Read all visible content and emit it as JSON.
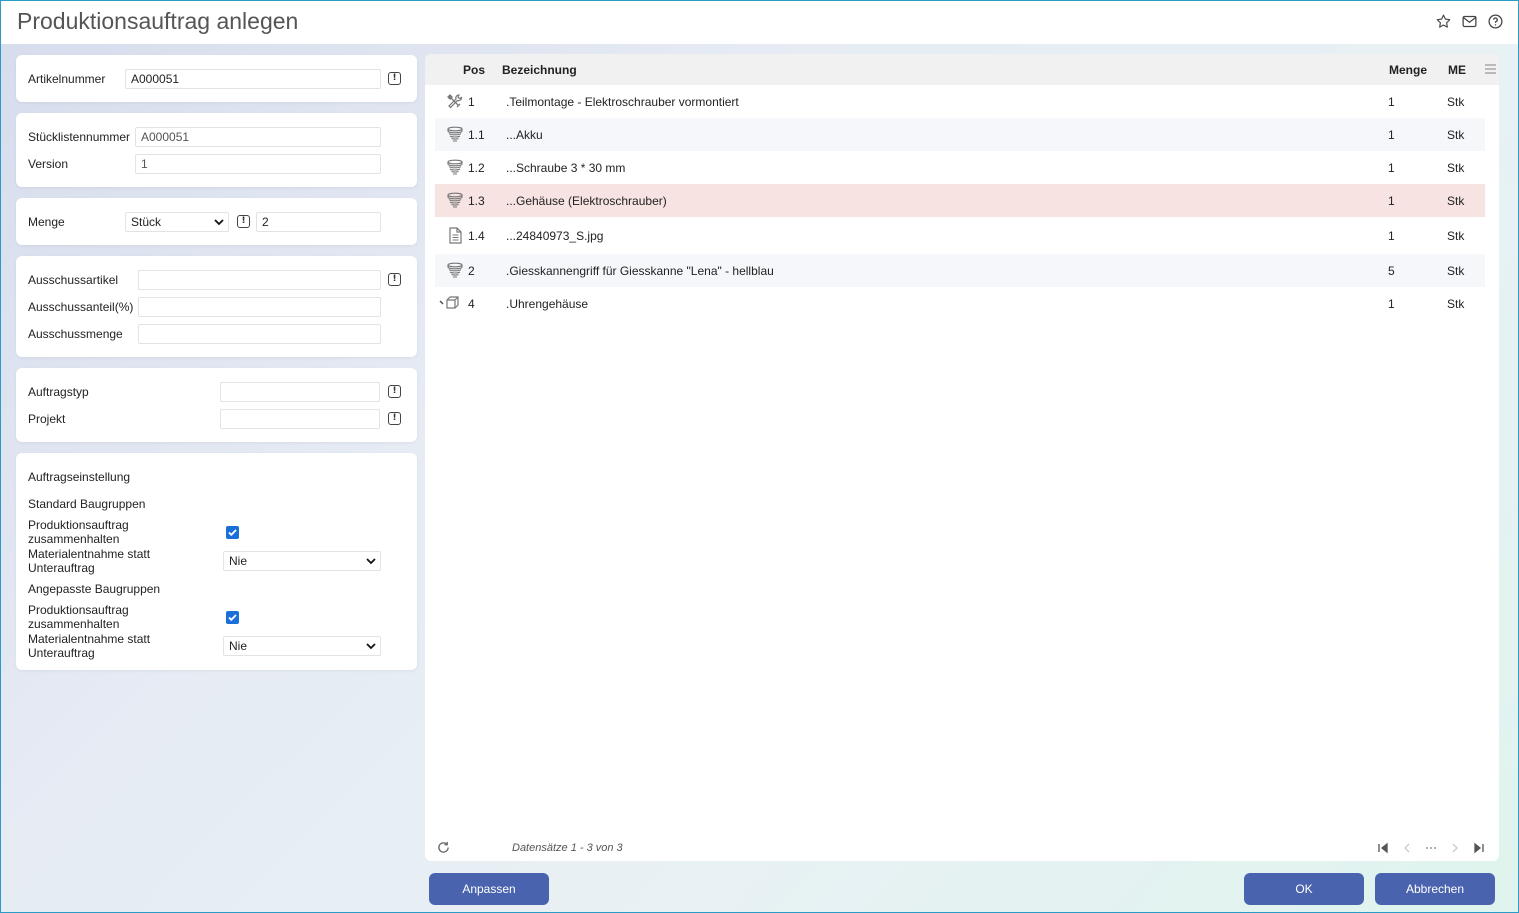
{
  "window": {
    "title": "Produktionsauftrag anlegen"
  },
  "header_icons": [
    "star-icon",
    "mail-icon",
    "help-icon"
  ],
  "article": {
    "label": "Artikelnummer",
    "value": "A000051"
  },
  "bom": {
    "number_label": "Stücklistennummer",
    "number_value": "A000051",
    "version_label": "Version",
    "version_value": "1"
  },
  "quantity": {
    "label": "Menge",
    "unit": "Stück",
    "value": "2"
  },
  "scrap": {
    "article_label": "Ausschussartikel",
    "article_value": "",
    "share_label": "Ausschussanteil(%)",
    "share_value": "",
    "qty_label": "Ausschussmenge",
    "qty_value": ""
  },
  "order": {
    "type_label": "Auftragstyp",
    "type_value": "",
    "project_label": "Projekt",
    "project_value": ""
  },
  "settings": {
    "title": "Auftragseinstellung",
    "standard": {
      "title": "Standard Baugruppen",
      "keep_label_1": "Produktionsauftrag",
      "keep_label_2": "zusammenhalten",
      "keep_checked": true,
      "withdraw_label_1": "Materialentnahme statt",
      "withdraw_label_2": "Unterauftrag",
      "withdraw_value": "Nie"
    },
    "custom": {
      "title": "Angepasste Baugruppen",
      "keep_label_1": "Produktionsauftrag",
      "keep_label_2": "zusammenhalten",
      "keep_checked": true,
      "withdraw_label_1": "Materialentnahme statt",
      "withdraw_label_2": "Unterauftrag",
      "withdraw_value": "Nie"
    }
  },
  "grid": {
    "headers": {
      "pos": "Pos",
      "bez": "Bezeichnung",
      "menge": "Menge",
      "me": "ME"
    },
    "rows": [
      {
        "icon": "tools-icon",
        "pos": "1",
        "bez": ".Teilmontage - Elektroschrauber vormontiert",
        "menge": "1",
        "me": "Stk"
      },
      {
        "icon": "stack-icon",
        "pos": "1.1",
        "bez": "...Akku",
        "menge": "1",
        "me": "Stk"
      },
      {
        "icon": "stack-icon",
        "pos": "1.2",
        "bez": "...Schraube 3 * 30 mm",
        "menge": "1",
        "me": "Stk"
      },
      {
        "icon": "stack-icon",
        "pos": "1.3",
        "bez": "...Gehäuse (Elektroschrauber)",
        "menge": "1",
        "me": "Stk"
      },
      {
        "icon": "document-icon",
        "pos": "1.4",
        "bez": "...24840973_S.jpg",
        "menge": "1",
        "me": "Stk"
      },
      {
        "icon": "stack-icon",
        "pos": "2",
        "bez": ".Giesskannengriff für Giesskanne \"Lena\" - hellblau",
        "menge": "5",
        "me": "Stk"
      },
      {
        "icon": "box-icon",
        "pos": "4",
        "bez": ".Uhrengehäuse",
        "menge": "1",
        "me": "Stk"
      }
    ],
    "selected_row": "1.3",
    "footer": "Datensätze 1 - 3 von 3"
  },
  "buttons": {
    "adjust": "Anpassen",
    "ok": "OK",
    "cancel": "Abbrechen"
  }
}
